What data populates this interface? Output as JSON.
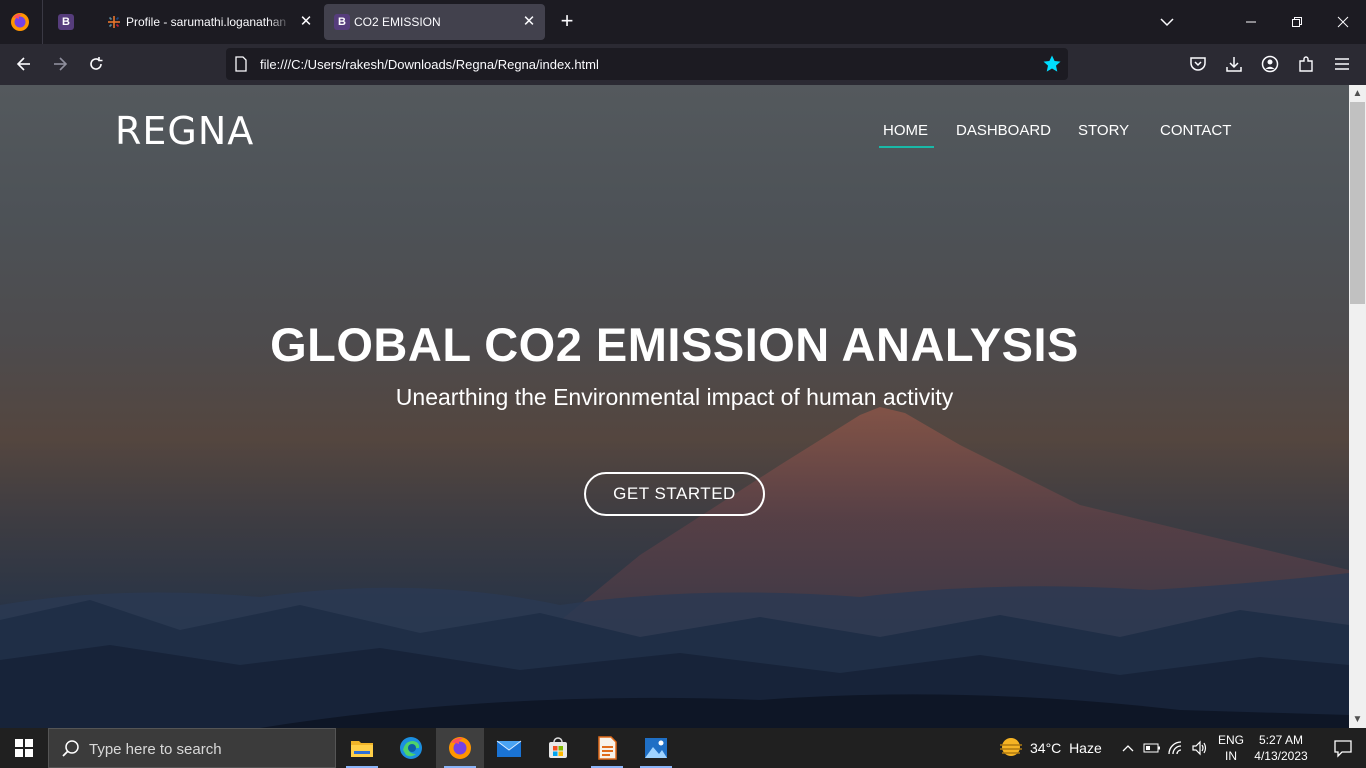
{
  "browser": {
    "tabs": [
      {
        "title": "Profile - sarumathi.loganathan",
        "active": false
      },
      {
        "title": "CO2 EMISSION",
        "active": true
      }
    ],
    "url": "file:///C:/Users/rakesh/Downloads/Regna/Regna/index.html"
  },
  "site": {
    "brand": "REGNA",
    "nav": [
      {
        "label": "HOME",
        "active": true
      },
      {
        "label": "DASHBOARD",
        "active": false
      },
      {
        "label": "STORY",
        "active": false
      },
      {
        "label": "CONTACT",
        "active": false
      }
    ],
    "hero": {
      "title": "GLOBAL CO2 EMISSION ANALYSIS",
      "subtitle": "Unearthing the Environmental impact of human activity",
      "cta": "GET STARTED"
    },
    "accent_color": "#19b9a8"
  },
  "taskbar": {
    "search_placeholder": "Type here to search",
    "weather": {
      "temp": "34°C",
      "condition": "Haze"
    },
    "language": {
      "line1": "ENG",
      "line2": "IN"
    },
    "clock": {
      "time": "5:27 AM",
      "date": "4/13/2023"
    },
    "apps": [
      "file-explorer",
      "edge",
      "firefox",
      "mail",
      "store",
      "document",
      "photos"
    ]
  }
}
